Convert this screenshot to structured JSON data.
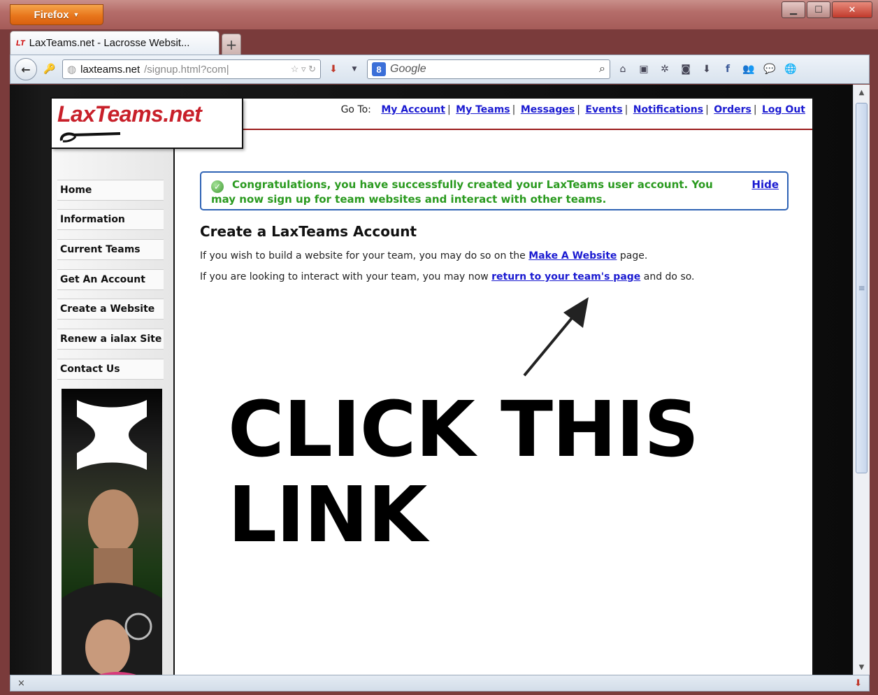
{
  "browser": {
    "firefox_button": "Firefox",
    "tab_title": "LaxTeams.net - Lacrosse Websit...",
    "tab_favicon": "LT",
    "url_host": "laxteams.net",
    "url_path": "/signup.html?com|",
    "search_placeholder": "Google",
    "status_text": "×"
  },
  "site": {
    "logo": "LaxTeams.net",
    "goto_label": "Go To:",
    "nav": [
      "My Account",
      "My Teams",
      "Messages",
      "Events",
      "Notifications",
      "Orders",
      "Log Out"
    ]
  },
  "sidebar": {
    "items": [
      "Home",
      "Information",
      "Current Teams",
      "Get An Account",
      "Create a Website",
      "Renew a ialax Site",
      "Contact Us"
    ]
  },
  "main": {
    "alert_text": "Congratulations, you have successfully created your LaxTeams user account. You may now sign up for team websites and interact with other teams.",
    "hide_label": "Hide",
    "heading": "Create a LaxTeams Account",
    "para1_before": "If you wish to build a website for your team, you may do so on the ",
    "para1_link": "Make A Website",
    "para1_after": " page.",
    "para2_before": "If you are looking to interact with your team, you may now ",
    "para2_link": "return to your team's page",
    "para2_after": " and do so."
  },
  "annotation": {
    "line1": "CLICK THIS",
    "line2": "LINK"
  },
  "colors": {
    "logo_red": "#c8202a",
    "link_blue": "#1b1bd1",
    "success_green": "#2a9a1f",
    "alert_border": "#2f63b5"
  }
}
